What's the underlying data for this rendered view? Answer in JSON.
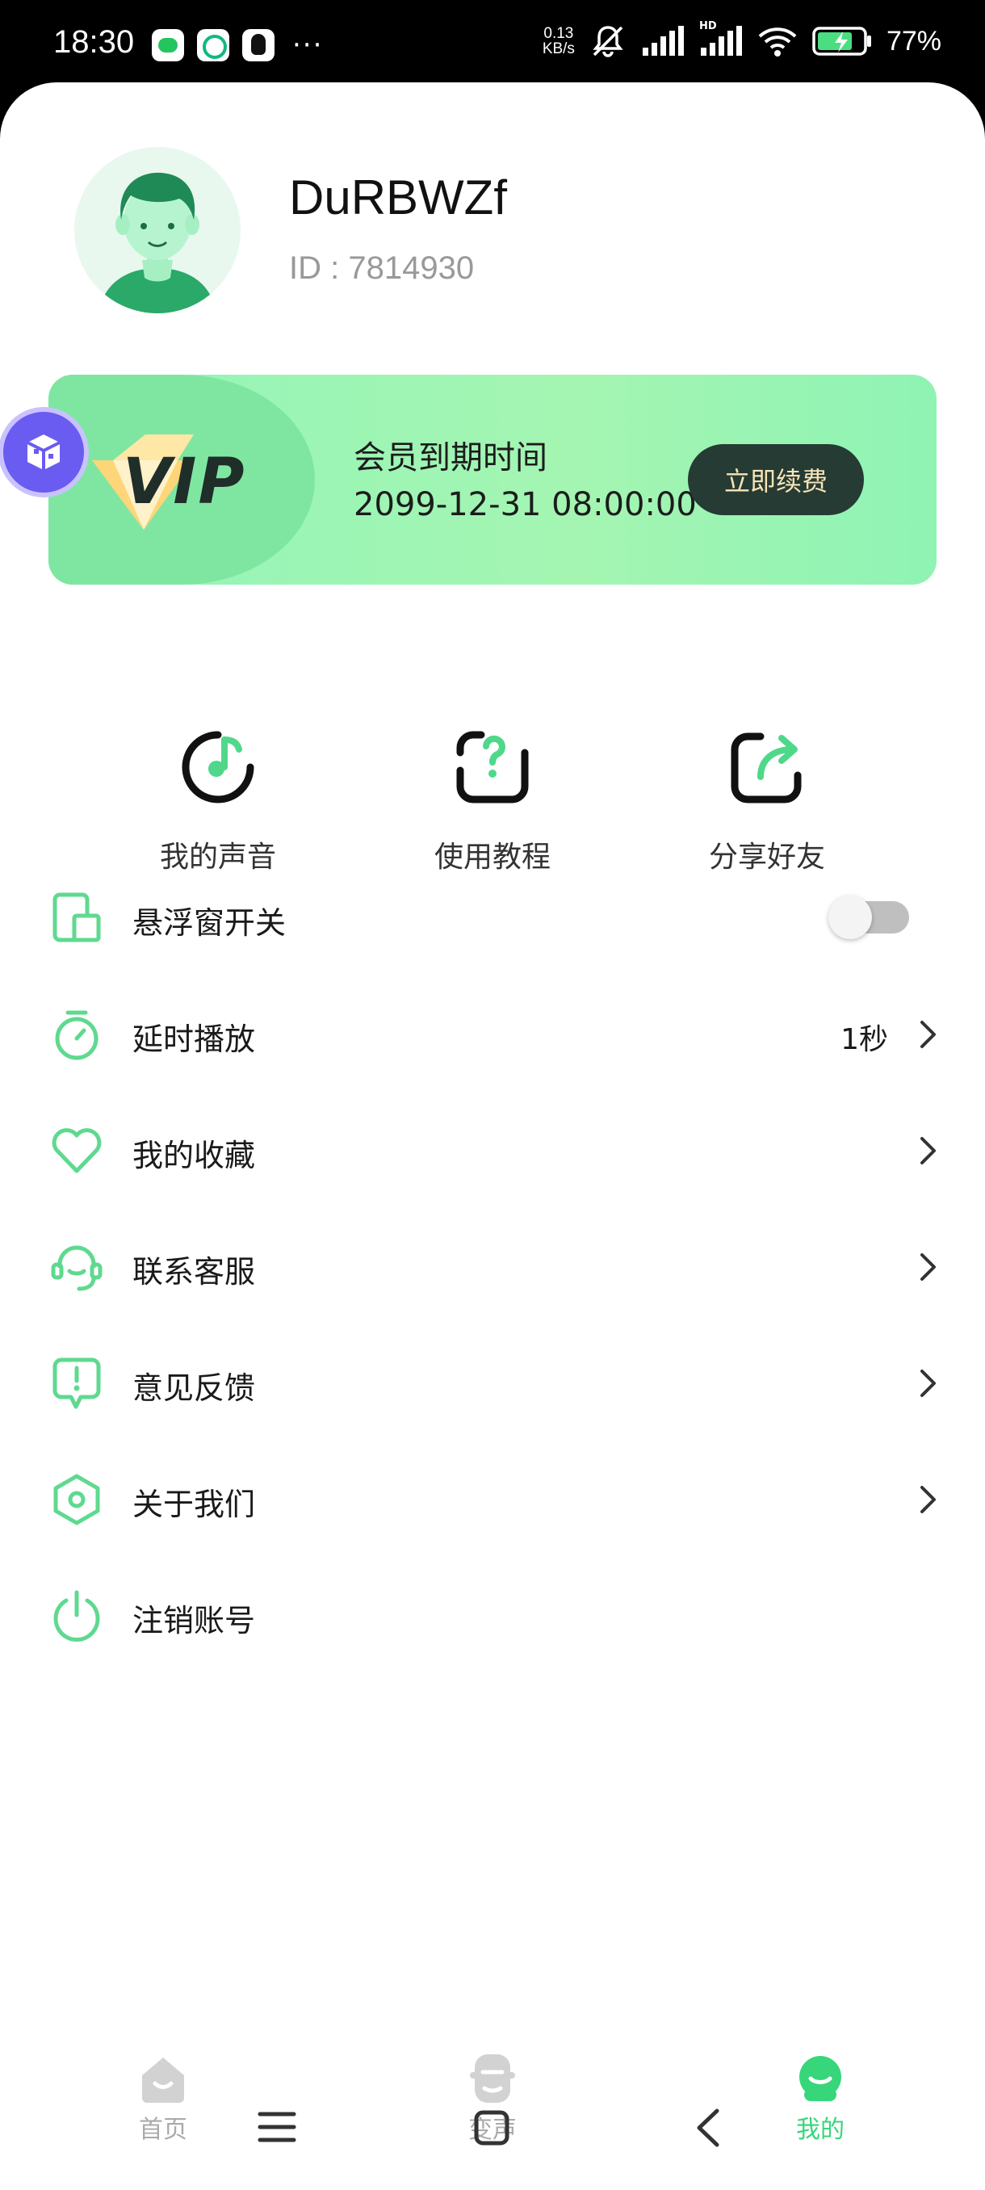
{
  "status_bar": {
    "time": "18:30",
    "net_speed_value": "0.13",
    "net_speed_unit": "KB/s",
    "network_label": "HD",
    "battery": "77%"
  },
  "profile": {
    "username": "DuRBWZf",
    "id_text": "ID : 7814930"
  },
  "vip": {
    "badge": "VIP",
    "title": "会员到期时间",
    "expiry": "2099-12-31 08:00:00",
    "renew_button": "立即续费"
  },
  "quick_actions": [
    {
      "label": "我的声音",
      "icon": "music-note-icon"
    },
    {
      "label": "使用教程",
      "icon": "question-frame-icon"
    },
    {
      "label": "分享好友",
      "icon": "share-icon"
    }
  ],
  "menu": [
    {
      "label": "悬浮窗开关",
      "icon": "floating-window-icon",
      "toggle": false
    },
    {
      "label": "延时播放",
      "icon": "timer-icon",
      "value": "1秒"
    },
    {
      "label": "我的收藏",
      "icon": "heart-icon"
    },
    {
      "label": "联系客服",
      "icon": "headset-icon"
    },
    {
      "label": "意见反馈",
      "icon": "feedback-icon"
    },
    {
      "label": "关于我们",
      "icon": "hexagon-icon"
    },
    {
      "label": "注销账号",
      "icon": "power-icon"
    }
  ],
  "tabs": [
    {
      "label": "首页",
      "icon": "home-icon"
    },
    {
      "label": "变声",
      "icon": "voice-change-icon"
    },
    {
      "label": "我的",
      "icon": "mine-icon",
      "active": true
    }
  ],
  "colors": {
    "accent": "#37d67a",
    "icon_green": "#5fd98f",
    "vip_dark": "#263b33"
  }
}
